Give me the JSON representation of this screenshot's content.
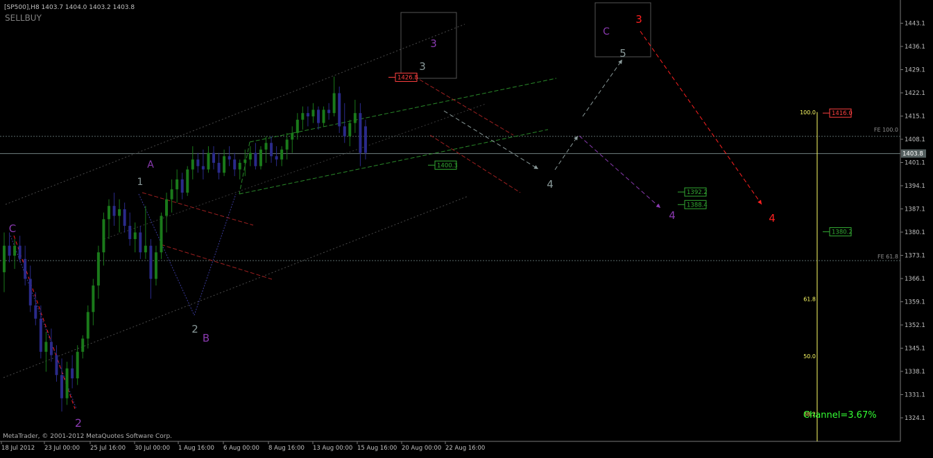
{
  "window": {
    "header": "[SP500],H8  1403.7 1404.0 1403.2 1403.8",
    "indicator": "SELLBUY",
    "copyright": "MetaTrader, © 2001-2012 MetaQuotes Software Corp."
  },
  "colors": {
    "background": "#000000",
    "bull_candle": "#1a7a1a",
    "bear_candle": "#2a2a8a",
    "grid": "#2a3a3a",
    "axis_text": "#c0c0c0",
    "wave_gray": "#8a9a9a",
    "wave_purple": "#8a3ab0",
    "wave_red": "#ff2020",
    "channel_green": "#2a8a2a",
    "channel_red": "#a02020",
    "fib_yellow": "#ffff66",
    "channel_text": "#33ff33"
  },
  "chart_data": {
    "type": "candlestick",
    "symbol": "SP500",
    "timeframe": "H8",
    "price_axis": {
      "ticks": [
        1443.1,
        1436.1,
        1429.1,
        1422.1,
        1415.1,
        1408.1,
        1401.1,
        1394.1,
        1387.1,
        1380.1,
        1373.1,
        1366.1,
        1359.1,
        1352.1,
        1345.1,
        1338.1,
        1331.1,
        1324.1
      ],
      "current_price": "1403.8",
      "ylim": [
        1320.0,
        1448.0
      ]
    },
    "time_axis": {
      "labels": [
        "18 Jul 2012",
        "23 Jul 00:00",
        "25 Jul 16:00",
        "30 Jul 00:00",
        "1 Aug 16:00",
        "6 Aug 00:00",
        "8 Aug 16:00",
        "13 Aug 00:00",
        "15 Aug 16:00",
        "20 Aug 00:00",
        "22 Aug 16:00"
      ]
    },
    "price_markers": [
      {
        "label": "1426.8",
        "price": 1426.8,
        "color": "#ff4040"
      },
      {
        "label": "1400.3",
        "price": 1400.3,
        "color": "#33aa33"
      },
      {
        "label": "1392.2",
        "price": 1392.2,
        "color": "#33aa33"
      },
      {
        "label": "1388.4",
        "price": 1388.4,
        "color": "#33aa33"
      },
      {
        "label": "1380.2",
        "price": 1380.2,
        "color": "#33aa33"
      },
      {
        "label": "1416.0",
        "price": 1416.0,
        "color": "#ff4040"
      }
    ],
    "levels": [
      {
        "label": "FE 100.0",
        "price": 1409.0
      },
      {
        "label": "FE 61.8",
        "price": 1371.5
      }
    ],
    "fibo": {
      "labels": [
        "100.0",
        "61.8",
        "50.0",
        "38.2"
      ],
      "prices": [
        1416.3,
        1359.9,
        1342.7,
        1325.3
      ]
    },
    "wave_labels": [
      {
        "text": "C",
        "color": "purple"
      },
      {
        "text": "2",
        "color": "purple"
      },
      {
        "text": "1",
        "color": "gray"
      },
      {
        "text": "A",
        "color": "purple"
      },
      {
        "text": "2",
        "color": "gray"
      },
      {
        "text": "B",
        "color": "purple"
      },
      {
        "text": "3",
        "color": "purple"
      },
      {
        "text": "3",
        "color": "gray"
      },
      {
        "text": "4",
        "color": "gray"
      },
      {
        "text": "4",
        "color": "purple"
      },
      {
        "text": "5",
        "color": "gray"
      },
      {
        "text": "C",
        "color": "purple"
      },
      {
        "text": "3",
        "color": "red"
      },
      {
        "text": "4",
        "color": "red"
      }
    ],
    "channel_text": "Channel=3.67%",
    "candles": [
      {
        "o": 1368,
        "h": 1380,
        "l": 1362,
        "c": 1376
      },
      {
        "o": 1376,
        "h": 1380,
        "l": 1371,
        "c": 1373
      },
      {
        "o": 1373,
        "h": 1378,
        "l": 1369,
        "c": 1376
      },
      {
        "o": 1376,
        "h": 1379,
        "l": 1371,
        "c": 1372
      },
      {
        "o": 1372,
        "h": 1376,
        "l": 1364,
        "c": 1366
      },
      {
        "o": 1366,
        "h": 1370,
        "l": 1356,
        "c": 1358
      },
      {
        "o": 1358,
        "h": 1362,
        "l": 1352,
        "c": 1354
      },
      {
        "o": 1354,
        "h": 1358,
        "l": 1342,
        "c": 1344
      },
      {
        "o": 1344,
        "h": 1350,
        "l": 1338,
        "c": 1347
      },
      {
        "o": 1347,
        "h": 1351,
        "l": 1341,
        "c": 1343
      },
      {
        "o": 1343,
        "h": 1346,
        "l": 1335,
        "c": 1337
      },
      {
        "o": 1337,
        "h": 1342,
        "l": 1326,
        "c": 1330
      },
      {
        "o": 1330,
        "h": 1341,
        "l": 1328,
        "c": 1339
      },
      {
        "o": 1339,
        "h": 1343,
        "l": 1333,
        "c": 1336
      },
      {
        "o": 1336,
        "h": 1346,
        "l": 1334,
        "c": 1344
      },
      {
        "o": 1344,
        "h": 1349,
        "l": 1342,
        "c": 1348
      },
      {
        "o": 1348,
        "h": 1358,
        "l": 1345,
        "c": 1356
      },
      {
        "o": 1356,
        "h": 1366,
        "l": 1352,
        "c": 1364
      },
      {
        "o": 1364,
        "h": 1376,
        "l": 1360,
        "c": 1374
      },
      {
        "o": 1374,
        "h": 1386,
        "l": 1370,
        "c": 1384
      },
      {
        "o": 1384,
        "h": 1390,
        "l": 1378,
        "c": 1388
      },
      {
        "o": 1388,
        "h": 1392,
        "l": 1382,
        "c": 1385
      },
      {
        "o": 1385,
        "h": 1390,
        "l": 1380,
        "c": 1387
      },
      {
        "o": 1387,
        "h": 1389,
        "l": 1380,
        "c": 1382
      },
      {
        "o": 1382,
        "h": 1386,
        "l": 1376,
        "c": 1378
      },
      {
        "o": 1378,
        "h": 1383,
        "l": 1374,
        "c": 1380
      },
      {
        "o": 1380,
        "h": 1382,
        "l": 1372,
        "c": 1374
      },
      {
        "o": 1374,
        "h": 1388,
        "l": 1372,
        "c": 1376
      },
      {
        "o": 1376,
        "h": 1378,
        "l": 1360,
        "c": 1366
      },
      {
        "o": 1366,
        "h": 1376,
        "l": 1364,
        "c": 1374
      },
      {
        "o": 1374,
        "h": 1386,
        "l": 1372,
        "c": 1385
      },
      {
        "o": 1385,
        "h": 1392,
        "l": 1380,
        "c": 1390
      },
      {
        "o": 1390,
        "h": 1396,
        "l": 1386,
        "c": 1393
      },
      {
        "o": 1393,
        "h": 1399,
        "l": 1389,
        "c": 1396
      },
      {
        "o": 1396,
        "h": 1398,
        "l": 1390,
        "c": 1392
      },
      {
        "o": 1392,
        "h": 1400,
        "l": 1391,
        "c": 1399
      },
      {
        "o": 1399,
        "h": 1406,
        "l": 1396,
        "c": 1402
      },
      {
        "o": 1402,
        "h": 1404,
        "l": 1398,
        "c": 1400
      },
      {
        "o": 1400,
        "h": 1405,
        "l": 1396,
        "c": 1399
      },
      {
        "o": 1399,
        "h": 1406,
        "l": 1398,
        "c": 1404
      },
      {
        "o": 1404,
        "h": 1406,
        "l": 1399,
        "c": 1401
      },
      {
        "o": 1401,
        "h": 1404,
        "l": 1396,
        "c": 1398
      },
      {
        "o": 1398,
        "h": 1405,
        "l": 1397,
        "c": 1403
      },
      {
        "o": 1403,
        "h": 1406,
        "l": 1400,
        "c": 1402
      },
      {
        "o": 1402,
        "h": 1404,
        "l": 1397,
        "c": 1399
      },
      {
        "o": 1399,
        "h": 1402,
        "l": 1396,
        "c": 1401
      },
      {
        "o": 1401,
        "h": 1405,
        "l": 1397,
        "c": 1402
      },
      {
        "o": 1402,
        "h": 1406,
        "l": 1400,
        "c": 1404
      },
      {
        "o": 1404,
        "h": 1407,
        "l": 1399,
        "c": 1400
      },
      {
        "o": 1400,
        "h": 1406,
        "l": 1399,
        "c": 1405
      },
      {
        "o": 1405,
        "h": 1409,
        "l": 1401,
        "c": 1407
      },
      {
        "o": 1407,
        "h": 1409,
        "l": 1401,
        "c": 1403
      },
      {
        "o": 1403,
        "h": 1406,
        "l": 1400,
        "c": 1402
      },
      {
        "o": 1402,
        "h": 1406,
        "l": 1400,
        "c": 1405
      },
      {
        "o": 1405,
        "h": 1410,
        "l": 1402,
        "c": 1408
      },
      {
        "o": 1408,
        "h": 1412,
        "l": 1404,
        "c": 1410
      },
      {
        "o": 1410,
        "h": 1416,
        "l": 1408,
        "c": 1414
      },
      {
        "o": 1414,
        "h": 1418,
        "l": 1411,
        "c": 1416
      },
      {
        "o": 1416,
        "h": 1418,
        "l": 1412,
        "c": 1415
      },
      {
        "o": 1415,
        "h": 1419,
        "l": 1413,
        "c": 1417
      },
      {
        "o": 1417,
        "h": 1418,
        "l": 1411,
        "c": 1413
      },
      {
        "o": 1413,
        "h": 1418,
        "l": 1412,
        "c": 1417
      },
      {
        "o": 1417,
        "h": 1419,
        "l": 1414,
        "c": 1416
      },
      {
        "o": 1416,
        "h": 1427,
        "l": 1415,
        "c": 1422
      },
      {
        "o": 1422,
        "h": 1424,
        "l": 1410,
        "c": 1412
      },
      {
        "o": 1412,
        "h": 1419,
        "l": 1407,
        "c": 1409
      },
      {
        "o": 1409,
        "h": 1414,
        "l": 1406,
        "c": 1413
      },
      {
        "o": 1413,
        "h": 1420,
        "l": 1410,
        "c": 1416
      },
      {
        "o": 1416,
        "h": 1419,
        "l": 1400,
        "c": 1404
      },
      {
        "o": 1412,
        "h": 1414,
        "l": 1402,
        "c": 1404
      }
    ]
  }
}
